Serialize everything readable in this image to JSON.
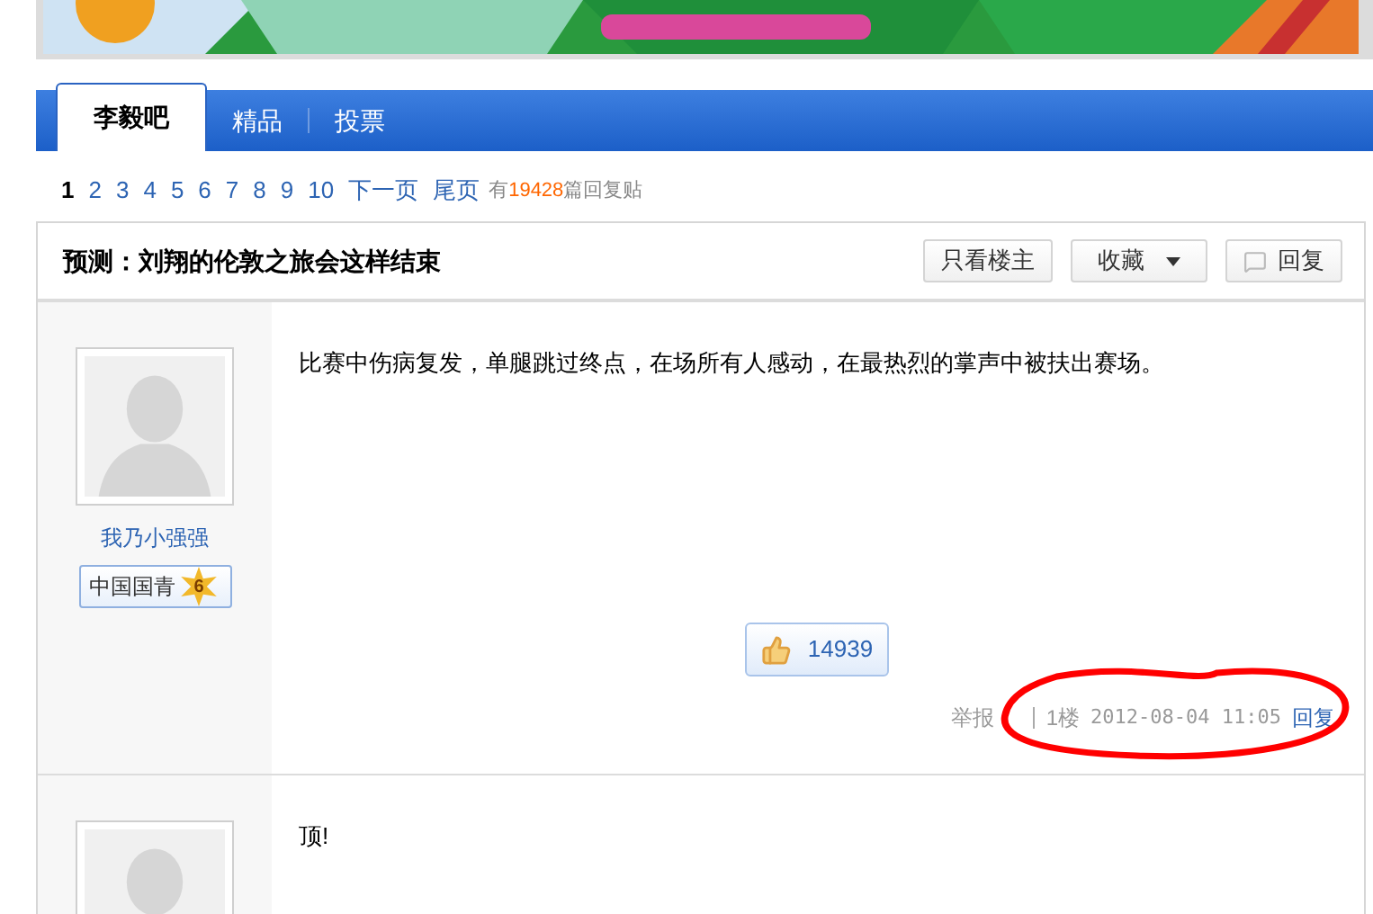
{
  "tabs": [
    {
      "label": "李毅吧",
      "selected": true
    },
    {
      "label": "精品",
      "selected": false
    },
    {
      "label": "投票",
      "selected": false
    }
  ],
  "pagination": {
    "pages": [
      {
        "label": "1",
        "selected": true
      },
      {
        "label": "2",
        "selected": false
      },
      {
        "label": "3",
        "selected": false
      },
      {
        "label": "4",
        "selected": false
      },
      {
        "label": "5",
        "selected": false
      },
      {
        "label": "6",
        "selected": false
      },
      {
        "label": "7",
        "selected": false
      },
      {
        "label": "8",
        "selected": false
      },
      {
        "label": "9",
        "selected": false
      },
      {
        "label": "10",
        "selected": false
      }
    ],
    "next": "下一页",
    "last": "尾页",
    "count_prefix": "有",
    "count": "19428",
    "count_suffix": "篇回复贴"
  },
  "thread": {
    "title": "预测：刘翔的伦敦之旅会这样结束",
    "buttons": [
      {
        "label": "只看楼主",
        "kind": "plain"
      },
      {
        "label": "收藏",
        "kind": "dropdown"
      },
      {
        "label": "回复",
        "kind": "reply"
      }
    ]
  },
  "posts": [
    {
      "author": "我乃小强强",
      "badge": {
        "label": "中国国青",
        "level": "6"
      },
      "content": "比赛中伤病复发，单腿跳过终点，在场所有人感动，在最热烈的掌声中被扶出赛场。",
      "likes": "14939",
      "report": "举报",
      "floor": "1楼",
      "time": "2012-08-04 11:05",
      "reply": "回复",
      "annotated": true
    },
    {
      "content": "顶!"
    }
  ]
}
